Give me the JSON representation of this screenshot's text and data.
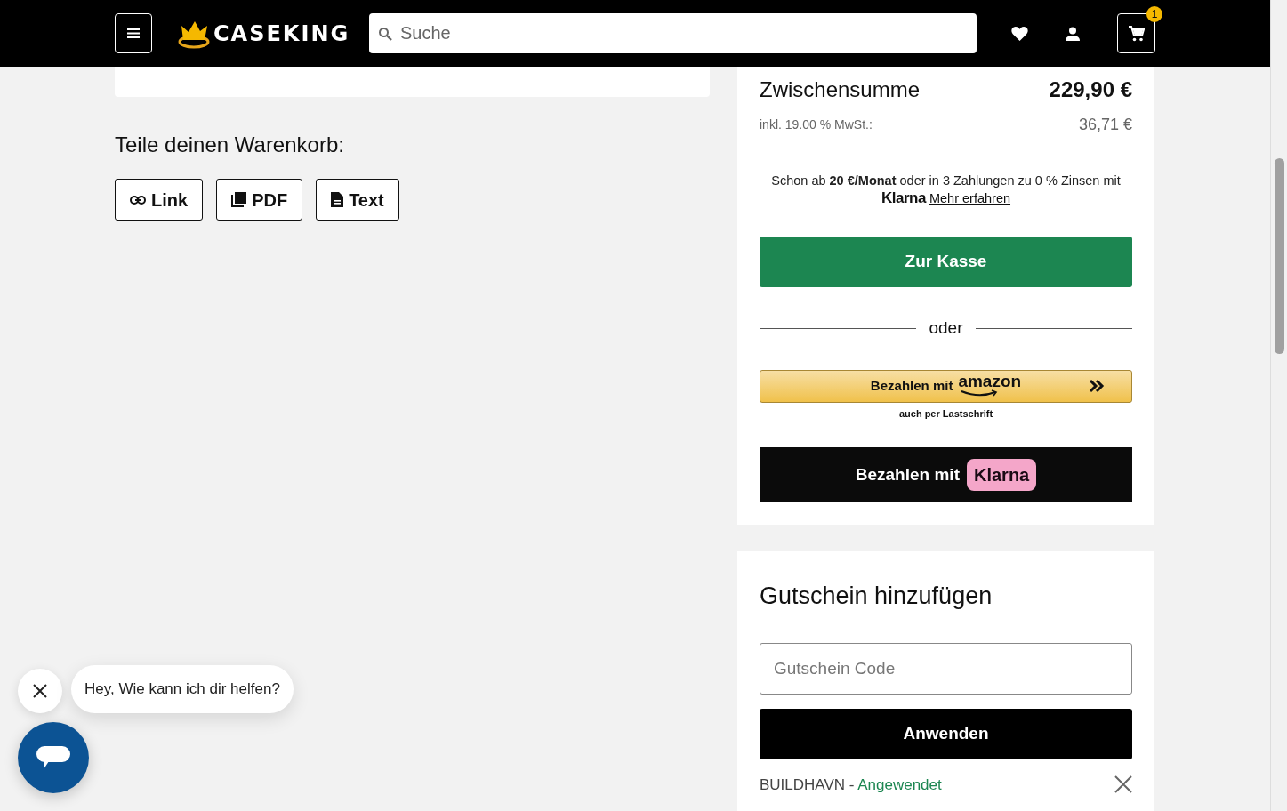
{
  "header": {
    "logo": "CASEKING",
    "search": {
      "placeholder": "Suche"
    },
    "cart_count": "1"
  },
  "share": {
    "title": "Teile deinen Warenkorb:",
    "buttons": [
      {
        "label": "Link",
        "kind": "link"
      },
      {
        "label": "PDF",
        "kind": "pdf"
      },
      {
        "label": "Text",
        "kind": "text"
      }
    ]
  },
  "summary": {
    "subtotal_label": "Zwischensumme",
    "subtotal": "229,90 €",
    "tax_label": "inkl. 19.00 % MwSt.:",
    "tax": "36,71 €",
    "financing_note": "Schon ab **20 €/Monat** oder in 3 Zahlungen zu 0 % Zinsen mit",
    "financing_brand": "Klarna",
    "financing_link": "Mehr erfahren",
    "checkout": "Zur Kasse",
    "divider": "oder",
    "amazon_pay": {
      "prefix": "Bezahlen mit",
      "brand": "amazon",
      "note": "auch per Lastschrift"
    },
    "klarna_pay": {
      "prefix": "Bezahlen mit",
      "brand": "Klarna"
    }
  },
  "coupon": {
    "title": "Gutschein hinzufügen",
    "placeholder": "Gutschein Code",
    "button": "Anwenden",
    "applied": {
      "code": "BUILDHAVN",
      "separator": "-",
      "status": "Angewendet"
    }
  },
  "chat": {
    "message": "Hey, Wie kann ich dir helfen?"
  }
}
